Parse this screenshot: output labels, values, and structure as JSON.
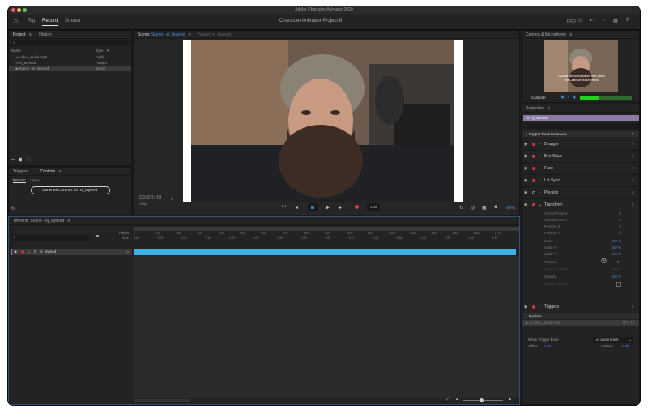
{
  "window": {
    "title": "Adobe Character Animator 2020"
  },
  "appbar": {
    "tabs": [
      "Rig",
      "Record",
      "Stream"
    ],
    "project_name": "Character Animator Project 6",
    "pro_label": "PRO"
  },
  "project_panel": {
    "tabs": [
      "Project",
      "History"
    ],
    "col_name": "Name",
    "col_type": "Type",
    "items": [
      {
        "name": "video_audio.mp3",
        "type": "Audio"
      },
      {
        "name": "ej_layered",
        "type": "Puppet"
      },
      {
        "name": "Scene - ej_layered",
        "type": "Scene"
      }
    ]
  },
  "controls_panel": {
    "tabs": [
      "Triggers",
      "Controls"
    ],
    "subtabs": [
      "Perform",
      "Layout"
    ],
    "generate_button": "Generate Controls for \"ej_layered\""
  },
  "scene_panel": {
    "tab_label": "Scene:",
    "tab_value": "Scene - ej_layered",
    "puppet_tab": "Puppet: ej_layered",
    "timecode": "00:00:00",
    "timecode_suffix": "0",
    "fps": "24 fps",
    "speed": "1.0x",
    "zoom": "(85%)"
  },
  "camera_panel": {
    "title": "Camera & Microphone",
    "hint": "Look at the Scene panel, then press the Calibrate button below",
    "calibrate": "Calibrate"
  },
  "properties_panel": {
    "title": "Properties",
    "selected": "ej_layered",
    "section": "Puppet Track Behaviors",
    "behaviors": [
      "Dragger",
      "Eye Gaze",
      "Face",
      "Lip Sync",
      "Physics",
      "Transform",
      "Triggers",
      "Replays"
    ],
    "transform_props": [
      {
        "name": "Anchor Point X",
        "value": "0"
      },
      {
        "name": "Anchor Point Y",
        "value": "0"
      },
      {
        "name": "Position X",
        "value": "0"
      },
      {
        "name": "Position Y",
        "value": "0"
      },
      {
        "name": "Scale",
        "value": "100 %"
      },
      {
        "name": "Scale X",
        "value": "100 %"
      },
      {
        "name": "Scale Y",
        "value": "100 %"
      },
      {
        "name": "Rotation",
        "value": "0 °"
      },
      {
        "name": "Group Strength",
        "value": "100 %"
      },
      {
        "name": "Opacity",
        "value": "100 %"
      },
      {
        "name": "Group Opacity",
        "value": ""
      }
    ],
    "replay_item": "video_audio.mp3",
    "replay_time": "RTS 1s",
    "when_trigger_ends_label": "When Trigger Ends",
    "when_trigger_ends_value": "Let audio finish",
    "offset_label": "Offset",
    "offset_value": "0 ms",
    "volume_label": "Volume",
    "volume_value": "0 dB"
  },
  "timeline_panel": {
    "title": "Timeline: Scene - ej_layered",
    "frames_label": "Frames",
    "mss_label": "m:ss",
    "track": "ej_layered",
    "frame_ticks": [
      "0",
      "100",
      "200",
      "300",
      "400",
      "500",
      "600",
      "700",
      "800",
      "900",
      "1000",
      "1100",
      "1200",
      "1300",
      "1400",
      "1500",
      "1600",
      "1700"
    ],
    "time_ticks": [
      "0:00",
      "0:05",
      "0:10",
      "0:15",
      "0:20",
      "0:25",
      "0:30",
      "0:35",
      "0:40",
      "0:45",
      "0:50",
      "0:55",
      "1:00",
      "1:05",
      "1:10",
      "1:15"
    ]
  }
}
